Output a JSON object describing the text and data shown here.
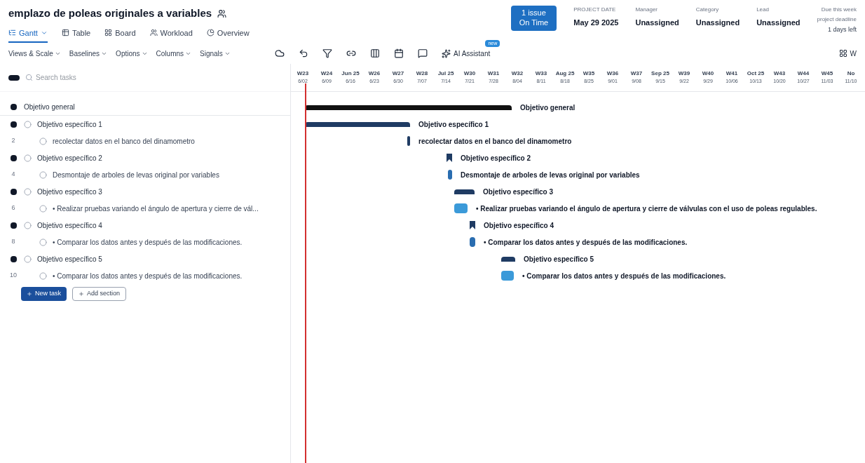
{
  "project": {
    "title": "emplazo de poleas originales a variables"
  },
  "status_button": {
    "line_1": "1 issue",
    "line_2": "On Time"
  },
  "fields": [
    {
      "label": "PROJECT DATE",
      "value": "May 29 2025"
    },
    {
      "label": "Manager",
      "value": "Unassigned"
    },
    {
      "label": "Category",
      "value": "Unassigned"
    },
    {
      "label": "Lead",
      "value": "Unassigned"
    }
  ],
  "due": {
    "label": "Due this week",
    "sublabel": "project deadline",
    "value": "1 days left"
  },
  "view_tabs": [
    {
      "label": "Gantt",
      "selected": true
    },
    {
      "label": "Table",
      "selected": false
    },
    {
      "label": "Board",
      "selected": false
    },
    {
      "label": "Workload",
      "selected": false
    },
    {
      "label": "Overview",
      "selected": false
    }
  ],
  "menus": [
    "Views & Scale",
    "Baselines",
    "Options",
    "Columns",
    "Signals"
  ],
  "toolbar_extra": {
    "label": "AI Assistant",
    "badge": "new",
    "zoom": "W"
  },
  "search": {
    "placeholder": "Search tasks"
  },
  "timeline": {
    "top": [
      "W23",
      "W24",
      "Jun 25",
      "W26",
      "W27",
      "W28",
      "Jul 25",
      "W30",
      "W31",
      "W32",
      "W33",
      "Aug 25",
      "W35",
      "W36",
      "W37",
      "Sep 25",
      "W39",
      "W40",
      "W41",
      "Oct 25",
      "W43",
      "W44",
      "W45",
      "No"
    ],
    "dates": [
      "6/02",
      "6/09",
      "6/16",
      "6/23",
      "6/30",
      "7/07",
      "7/14",
      "7/21",
      "7/28",
      "8/04",
      "8/11",
      "8/18",
      "8/25",
      "9/01",
      "9/08",
      "9/15",
      "9/22",
      "9/29",
      "10/06",
      "10/13",
      "10/20",
      "10/27",
      "11/03",
      "11/10"
    ]
  },
  "rows": [
    {
      "kind": "group",
      "name": "Objetivo general",
      "bar": {
        "kind": "summary",
        "label": "Objetivo general",
        "color": "#111111"
      }
    },
    {
      "kind": "subgroup",
      "name": "Objetivo específico 1",
      "bar": {
        "kind": "summary",
        "label": "Objetivo específico 1",
        "color": "#1f3b63"
      }
    },
    {
      "kind": "task",
      "number": "2",
      "name": "recolectar datos en el banco del dinamometro",
      "bar": {
        "kind": "task",
        "label": "recolectar datos en el banco del dinamometro",
        "color": "#1f3b63"
      }
    },
    {
      "kind": "subgroup",
      "name": "Objetivo específico 2",
      "bar": {
        "kind": "milestone",
        "label": "Objetivo específico 2",
        "color": "#1f3b63"
      }
    },
    {
      "kind": "task",
      "number": "4",
      "name": "Desmontaje de arboles de levas original por variables",
      "bar": {
        "kind": "task",
        "label": "Desmontaje de arboles de levas original por variables",
        "color": "#2a6db0"
      }
    },
    {
      "kind": "subgroup",
      "name": "Objetivo específico 3",
      "bar": {
        "kind": "summary",
        "label": "Objetivo específico 3",
        "color": "#1f3b63"
      }
    },
    {
      "kind": "task",
      "number": "6",
      "name": "• Realizar pruebas variando el ángulo de apertura y cierre de vál...",
      "bar": {
        "kind": "task",
        "label": "• Realizar pruebas variando el ángulo de apertura y cierre de válvulas con el uso de poleas regulables.",
        "color": "#3b9ad9"
      }
    },
    {
      "kind": "subgroup",
      "name": "Objetivo específico 4",
      "bar": {
        "kind": "milestone",
        "label": "Objetivo específico 4",
        "color": "#1f3b63"
      }
    },
    {
      "kind": "task",
      "number": "8",
      "name": "• Comparar los datos antes y después de las modificaciones.",
      "bar": {
        "kind": "task",
        "label": "• Comparar los datos antes y después de las modificaciones.",
        "color": "#2a6db0"
      }
    },
    {
      "kind": "subgroup",
      "name": "Objetivo específico 5",
      "bar": {
        "kind": "summary",
        "label": "Objetivo específico 5",
        "color": "#1f3b63"
      }
    },
    {
      "kind": "task",
      "number": "10",
      "name": "• Comparar los datos antes y después de las modificaciones.",
      "bar": {
        "kind": "task",
        "label": "• Comparar los datos antes y después de las modificaciones.",
        "color": "#3b9ad9"
      }
    }
  ],
  "actions": [
    "New task",
    "Add section"
  ]
}
